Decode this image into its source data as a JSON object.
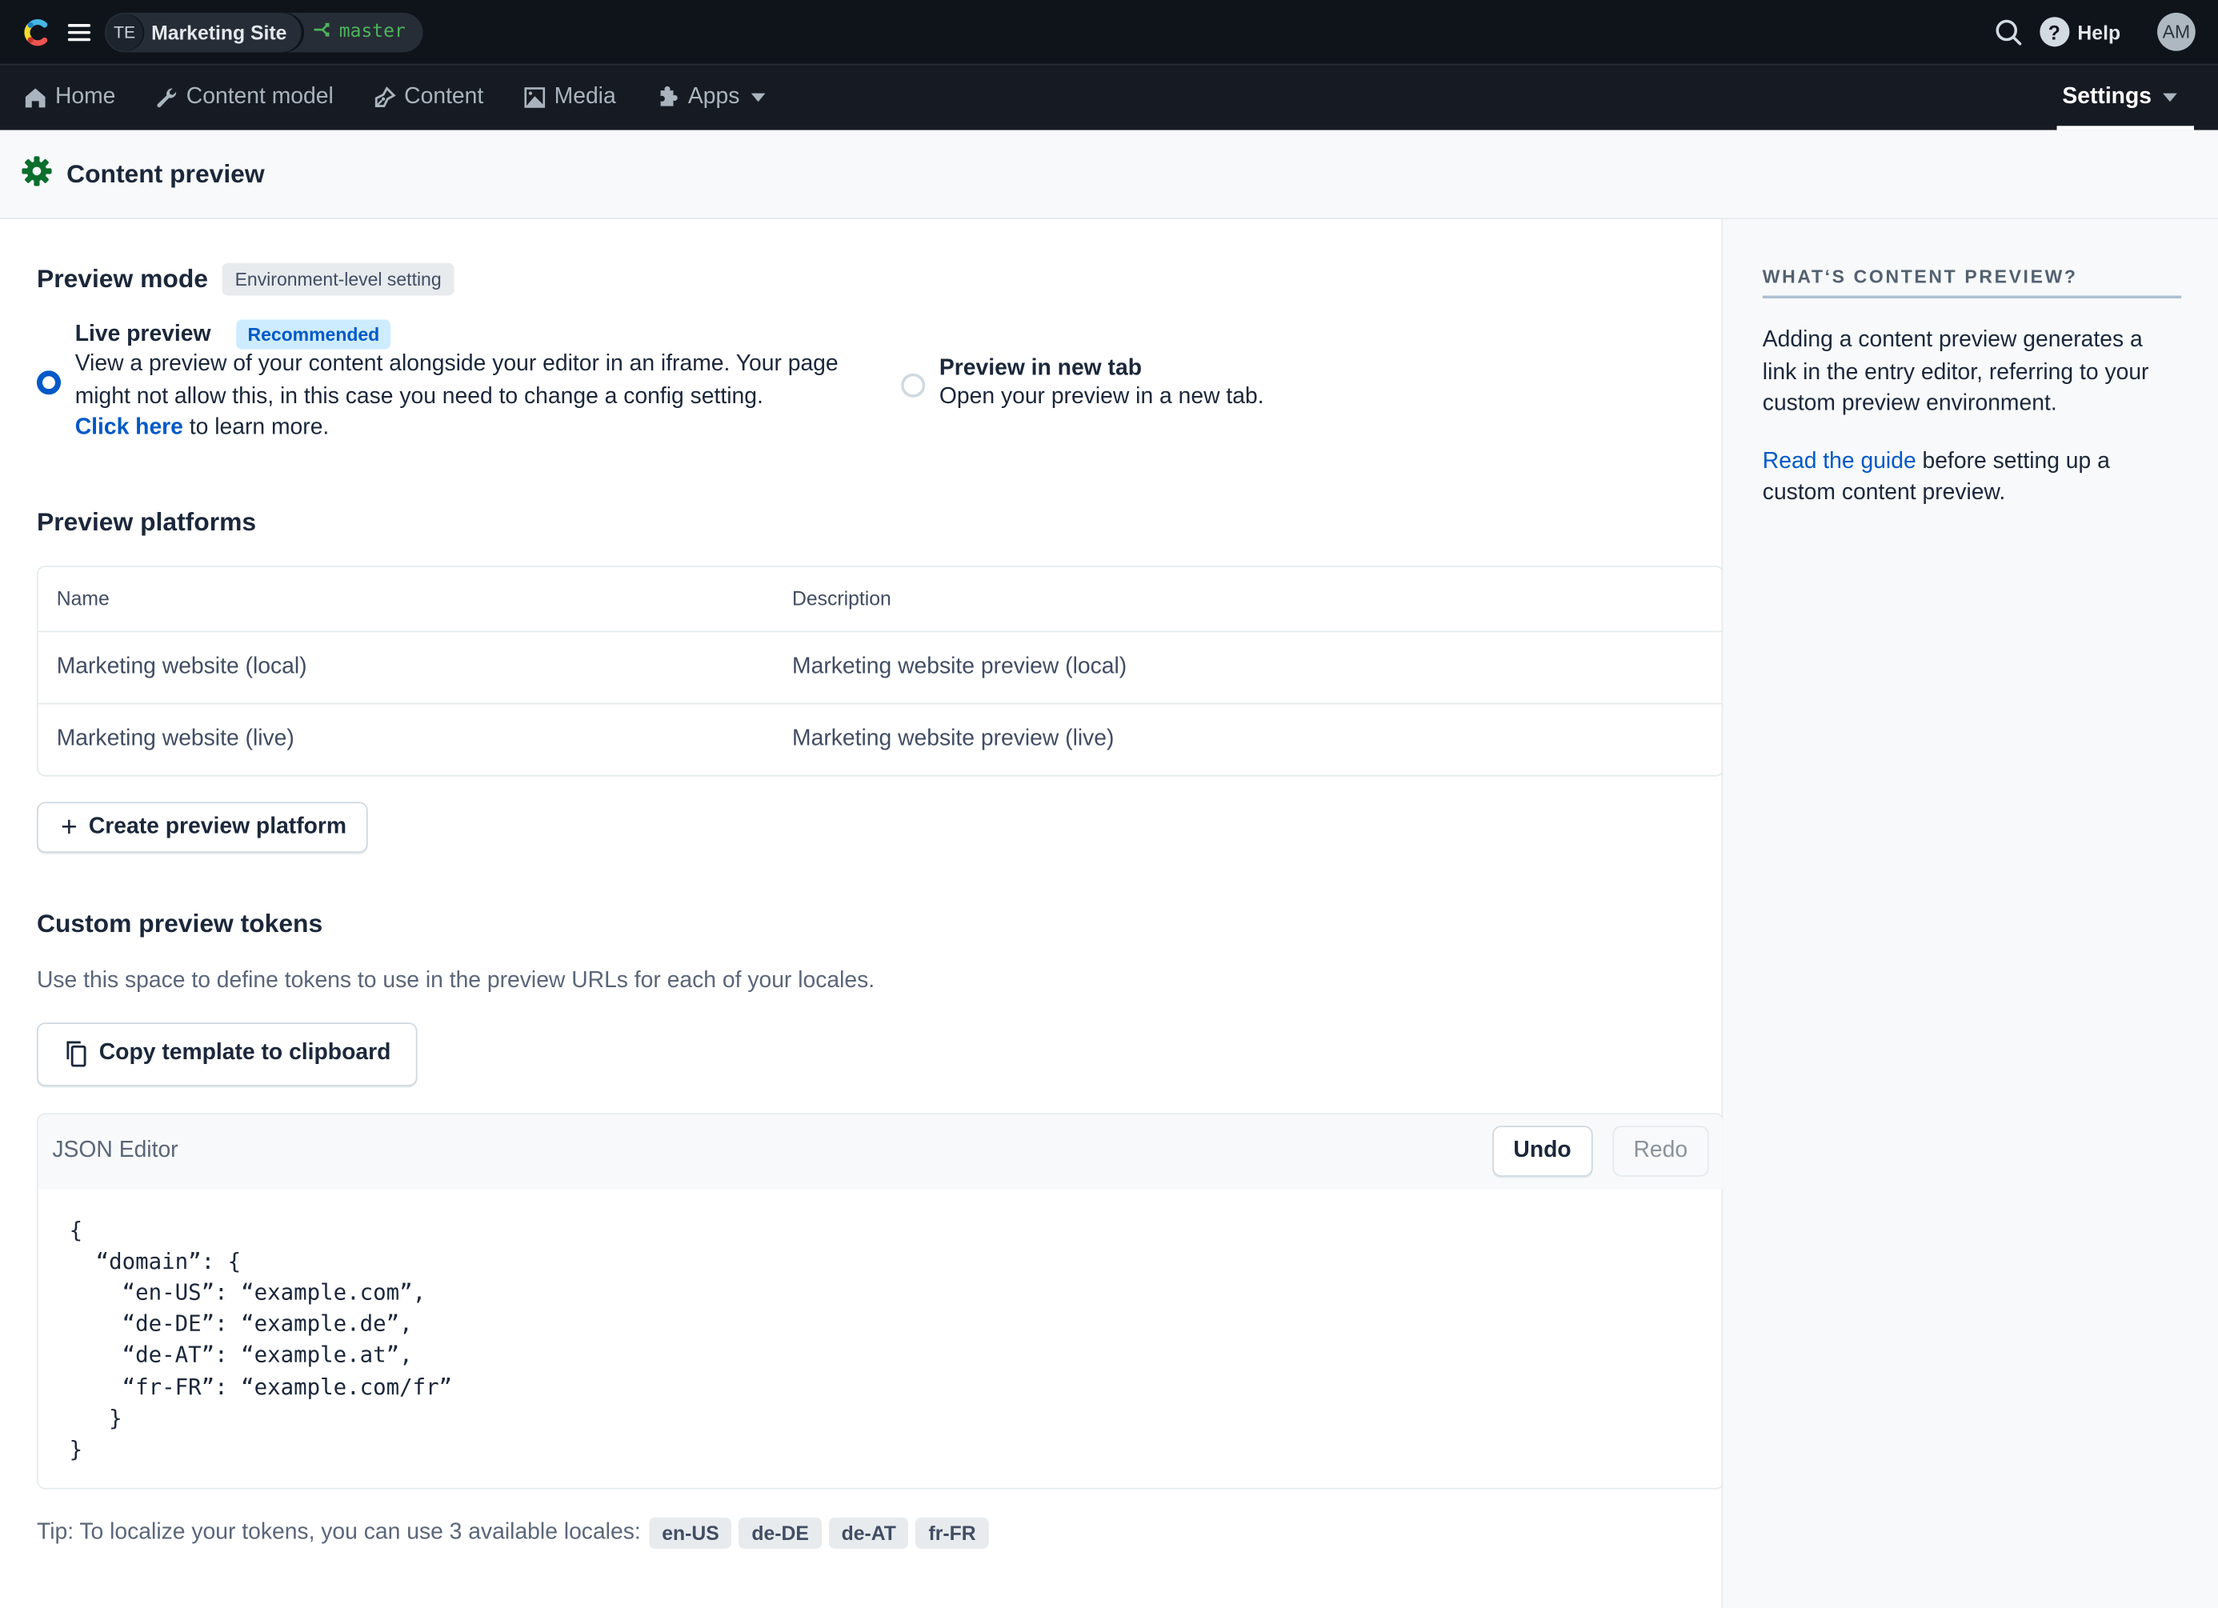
{
  "topbar": {
    "space_initials": "TE",
    "space_name": "Marketing Site",
    "environment": "master",
    "help_label": "Help",
    "user_initials": "AM"
  },
  "nav": {
    "items": [
      {
        "label": "Home",
        "icon": "home-icon"
      },
      {
        "label": "Content model",
        "icon": "wrench-icon"
      },
      {
        "label": "Content",
        "icon": "pen-icon"
      },
      {
        "label": "Media",
        "icon": "image-icon"
      },
      {
        "label": "Apps",
        "icon": "puzzle-icon",
        "dropdown": true
      }
    ],
    "settings_label": "Settings",
    "active": "Settings"
  },
  "page": {
    "title": "Content preview"
  },
  "preview_mode": {
    "heading": "Preview mode",
    "badge": "Environment-level setting",
    "selected": "live",
    "live": {
      "title": "Live preview",
      "badge": "Recommended",
      "description": "View a preview of your content alongside your editor in an iframe. Your page might not allow this, in this case you need to change a config setting.",
      "link_text": "Click here",
      "link_suffix": " to learn more."
    },
    "new_tab": {
      "title": "Preview in new tab",
      "description": "Open your preview in a new tab."
    }
  },
  "platforms": {
    "heading": "Preview platforms",
    "columns": [
      "Name",
      "Description"
    ],
    "rows": [
      {
        "name": "Marketing website (local)",
        "description": "Marketing website preview (local)"
      },
      {
        "name": "Marketing website (live)",
        "description": "Marketing website preview (live)"
      }
    ],
    "create_label": "Create preview platform"
  },
  "tokens": {
    "heading": "Custom preview tokens",
    "description": "Use this space to define tokens to use in the preview URLs for each of your locales.",
    "copy_label": "Copy template to clipboard",
    "editor_label": "JSON Editor",
    "undo_label": "Undo",
    "redo_label": "Redo",
    "code": "{\n  “domain”: {\n    “en-US”: “example.com”,\n    “de-DE”: “example.de”,\n    “de-AT”: “example.at”,\n    “fr-FR”: “example.com/fr”\n   }\n}",
    "tip": "Tip: To localize your tokens, you can use 3 available locales:",
    "locales": [
      "en-US",
      "de-DE",
      "de-AT",
      "fr-FR"
    ]
  },
  "sidebar": {
    "title": "WHAT‘S CONTENT PREVIEW?",
    "paragraph1": "Adding a content preview generates a link in the entry editor, referring to your custom preview environment.",
    "link_text": "Read the guide",
    "paragraph2_suffix": " before setting up a custom content preview."
  },
  "colors": {
    "accent": "#0059c8",
    "environment": "#4fb35c",
    "settings_gear": "#0a6e2c",
    "topbar_bg": "#0f141b",
    "navbar_bg": "#161b23"
  }
}
